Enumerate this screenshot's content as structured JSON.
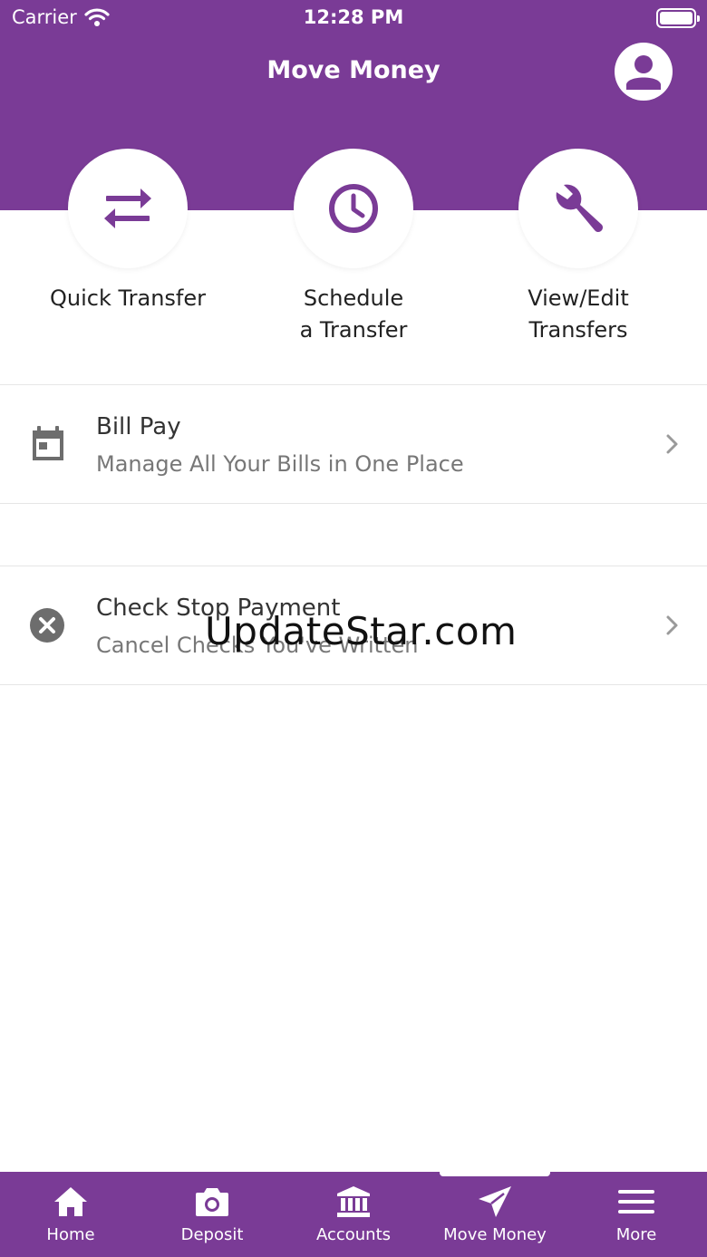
{
  "status": {
    "carrier": "Carrier",
    "time": "12:28 PM"
  },
  "header": {
    "title": "Move Money"
  },
  "actions": [
    {
      "label": "Quick Transfer",
      "icon": "swap-arrows-icon"
    },
    {
      "label": "Schedule\na Transfer",
      "icon": "clock-icon"
    },
    {
      "label": "View/Edit\nTransfers",
      "icon": "wrench-icon"
    }
  ],
  "list": [
    {
      "title": "Bill Pay",
      "subtitle": "Manage All Your Bills in One Place",
      "icon": "calendar-icon"
    },
    {
      "title": "Check Stop Payment",
      "subtitle": "Cancel Checks You've Written",
      "icon": "cancel-circle-icon"
    }
  ],
  "watermark": "UpdateStar.com",
  "tabs": [
    {
      "label": "Home",
      "icon": "home-icon"
    },
    {
      "label": "Deposit",
      "icon": "camera-icon"
    },
    {
      "label": "Accounts",
      "icon": "bank-icon"
    },
    {
      "label": "Move Money",
      "icon": "paper-plane-icon",
      "active": true
    },
    {
      "label": "More",
      "icon": "menu-icon"
    }
  ],
  "colors": {
    "brand": "#7a3b96",
    "icon_gray": "#6d6d6d",
    "text_secondary": "#777777"
  }
}
